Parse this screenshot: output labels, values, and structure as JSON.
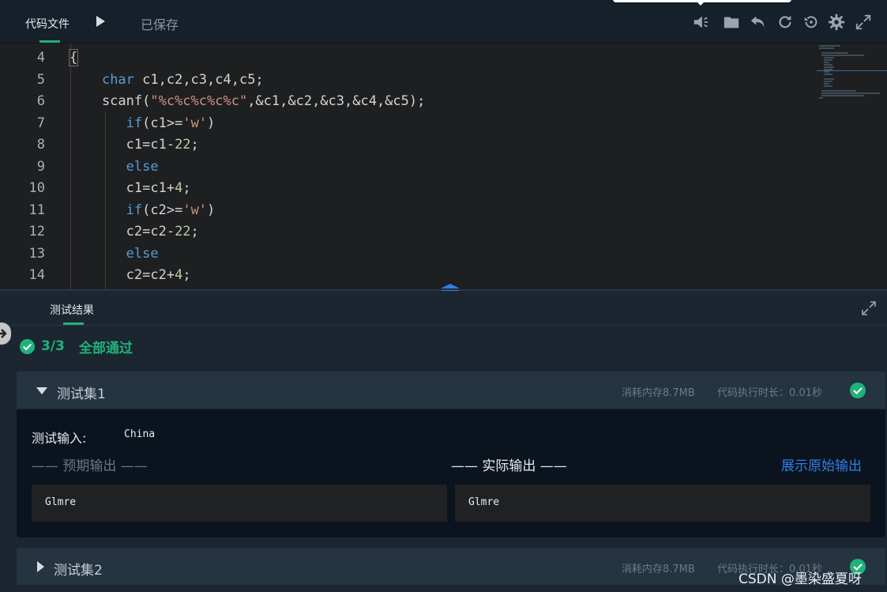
{
  "toolbar": {
    "tab_label": "代码文件",
    "save_status": "已保存",
    "icons": [
      "sound-icon",
      "folder-icon",
      "undo-icon",
      "refresh-icon",
      "history-icon",
      "gear-icon",
      "fullscreen-icon"
    ]
  },
  "editor": {
    "line_numbers": [
      "4",
      "5",
      "6",
      "7",
      "8",
      "9",
      "10",
      "11",
      "12",
      "13",
      "14"
    ],
    "lines": [
      "{",
      "    char c1,c2,c3,c4,c5;",
      "    scanf(\"%c%c%c%c%c\",&c1,&c2,&c3,&c4,&c5);",
      "       if(c1>='w')",
      "       c1=c1-22;",
      "       else",
      "       c1=c1+4;",
      "       if(c2>='w')",
      "       c2=c2-22;",
      "       else",
      "       c2=c2+4;"
    ]
  },
  "results": {
    "tab_label": "测试结果",
    "summary_count": "3/3",
    "summary_status": "全部通过",
    "cases": [
      {
        "title": "测试集1",
        "memory": "消耗内存8.7MB",
        "time": "代码执行时长：0.01秒",
        "input_label": "测试输入:",
        "input_value": "China",
        "expected_title": "—— 预期输出 ——",
        "actual_title": "—— 实际输出 ——",
        "raw_output_link": "展示原始输出",
        "expected_output": "Glmre",
        "actual_output": "Glmre"
      },
      {
        "title": "测试集2",
        "memory": "消耗内存8.7MB",
        "time": "代码执行时长：0.01秒"
      }
    ]
  },
  "watermark": "CSDN @墨染盛夏呀",
  "colors": {
    "accent": "#1fb37a",
    "link": "#2f7fe5",
    "keyword": "#569cd6",
    "string": "#ce9178",
    "number": "#b5cea8"
  }
}
